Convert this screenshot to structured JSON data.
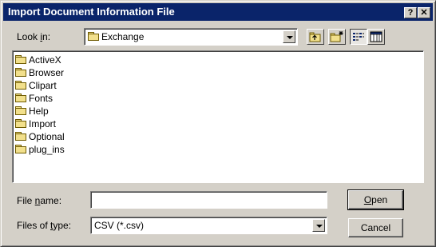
{
  "window": {
    "title": "Import Document Information File",
    "help_label": "?",
    "close_label": "✕"
  },
  "look_in": {
    "label_pre": "Look ",
    "label_accel": "i",
    "label_post": "n:",
    "value": "Exchange"
  },
  "toolbar": {
    "icons": [
      "up-folder-icon",
      "new-folder-icon",
      "list-view-icon",
      "details-view-icon"
    ]
  },
  "files": [
    "ActiveX",
    "Browser",
    "Clipart",
    "Fonts",
    "Help",
    "Import",
    "Optional",
    "plug_ins"
  ],
  "file_name": {
    "label_pre": "File ",
    "label_accel": "n",
    "label_post": "ame:",
    "value": ""
  },
  "files_of_type": {
    "label_pre": "Files of ",
    "label_accel": "t",
    "label_post": "ype:",
    "value": "CSV (*.csv)"
  },
  "buttons": {
    "open_accel": "O",
    "open_rest": "pen",
    "cancel": "Cancel"
  }
}
